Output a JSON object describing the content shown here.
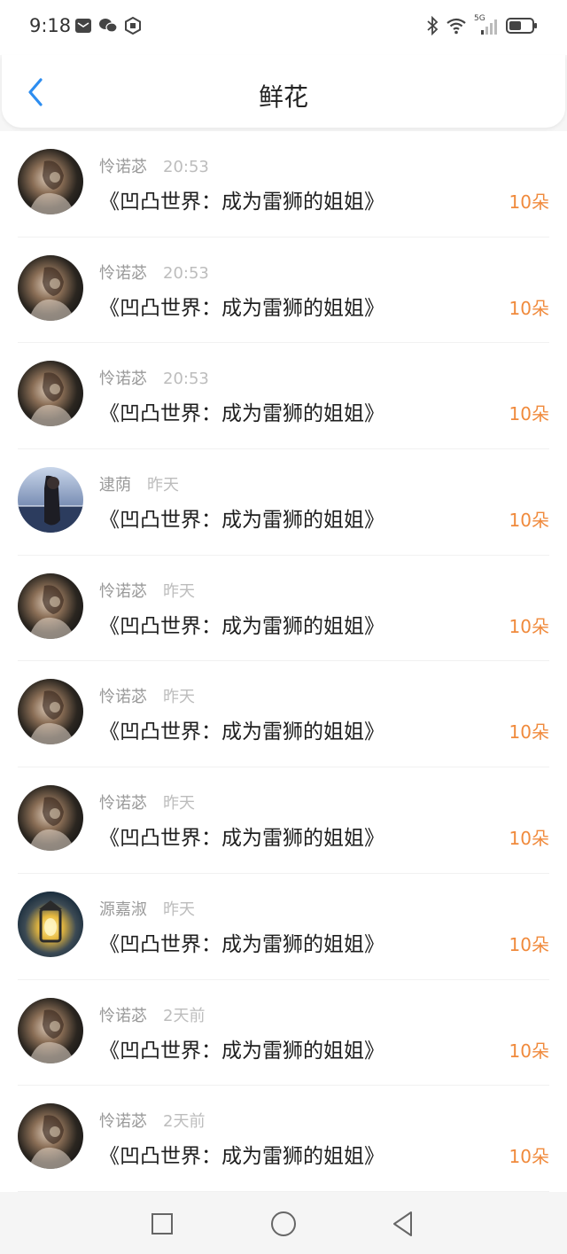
{
  "status_bar": {
    "time": "9:18",
    "left_icons": [
      "mail-icon",
      "wechat-icon",
      "app-icon"
    ],
    "right_icons": [
      "bluetooth-icon",
      "wifi-icon",
      "signal-5g-icon",
      "battery-icon"
    ],
    "network_label": "5G"
  },
  "header": {
    "back_icon": "chevron-left-icon",
    "title": "鲜花"
  },
  "colors": {
    "accent_blue": "#2d8df0",
    "count_orange": "#f08a3c",
    "muted_text": "#9a9a9a"
  },
  "items": [
    {
      "name": "怜诺苾",
      "time": "20:53",
      "title": "《凹凸世界：成为雷狮的姐姐》",
      "count": "10朵",
      "avatar": "dark-portrait"
    },
    {
      "name": "怜诺苾",
      "time": "20:53",
      "title": "《凹凸世界：成为雷狮的姐姐》",
      "count": "10朵",
      "avatar": "dark-portrait"
    },
    {
      "name": "怜诺苾",
      "time": "20:53",
      "title": "《凹凸世界：成为雷狮的姐姐》",
      "count": "10朵",
      "avatar": "dark-portrait"
    },
    {
      "name": "逮荫",
      "time": "昨天",
      "title": "《凹凸世界：成为雷狮的姐姐》",
      "count": "10朵",
      "avatar": "night-city"
    },
    {
      "name": "怜诺苾",
      "time": "昨天",
      "title": "《凹凸世界：成为雷狮的姐姐》",
      "count": "10朵",
      "avatar": "dark-portrait"
    },
    {
      "name": "怜诺苾",
      "time": "昨天",
      "title": "《凹凸世界：成为雷狮的姐姐》",
      "count": "10朵",
      "avatar": "dark-portrait"
    },
    {
      "name": "怜诺苾",
      "time": "昨天",
      "title": "《凹凸世界：成为雷狮的姐姐》",
      "count": "10朵",
      "avatar": "dark-portrait"
    },
    {
      "name": "源嘉淑",
      "time": "昨天",
      "title": "《凹凸世界：成为雷狮的姐姐》",
      "count": "10朵",
      "avatar": "lantern"
    },
    {
      "name": "怜诺苾",
      "time": "2天前",
      "title": "《凹凸世界：成为雷狮的姐姐》",
      "count": "10朵",
      "avatar": "dark-portrait"
    },
    {
      "name": "怜诺苾",
      "time": "2天前",
      "title": "《凹凸世界：成为雷狮的姐姐》",
      "count": "10朵",
      "avatar": "dark-portrait"
    }
  ],
  "nav_bar": {
    "buttons": [
      "recent-apps-icon",
      "home-icon",
      "back-triangle-icon"
    ]
  }
}
